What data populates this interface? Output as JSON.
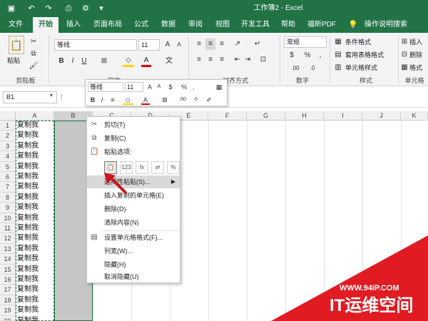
{
  "window": {
    "title": "工作簿2  -  Excel"
  },
  "tabs": [
    {
      "label": "文件"
    },
    {
      "label": "开始"
    },
    {
      "label": "插入"
    },
    {
      "label": "页面布局"
    },
    {
      "label": "公式"
    },
    {
      "label": "数据"
    },
    {
      "label": "审阅"
    },
    {
      "label": "视图"
    },
    {
      "label": "开发工具"
    },
    {
      "label": "帮助"
    },
    {
      "label": "福昕PDF"
    },
    {
      "label": "操作说明搜索"
    }
  ],
  "ribbon": {
    "clipboard": {
      "paste_label": "粘贴",
      "group_label": "剪贴板"
    },
    "font": {
      "name": "等线",
      "size": "11",
      "group_label": "字体"
    },
    "alignment": {
      "group_label": "对齐方式"
    },
    "number": {
      "format": "常规",
      "group_label": "数字"
    },
    "styles": {
      "conditional": "条件格式",
      "table": "套用表格格式",
      "cell": "单元格样式",
      "group_label": "样式"
    },
    "cells": {
      "insert": "插入",
      "delete": "删除",
      "format": "格式",
      "group_label": "单元格"
    }
  },
  "formula_bar": {
    "name_box": "B1"
  },
  "grid": {
    "columns": [
      "A",
      "B",
      "C",
      "D",
      "E",
      "F",
      "G",
      "H",
      "I",
      "J",
      "K"
    ],
    "rows": [
      "1",
      "2",
      "3",
      "4",
      "5",
      "6",
      "7",
      "8",
      "9",
      "10",
      "11",
      "12",
      "13",
      "14",
      "15",
      "16",
      "17",
      "18",
      "19",
      "20"
    ],
    "cell_text": "复制我"
  },
  "mini_toolbar": {
    "font_name": "等线",
    "font_size": "11",
    "percent": "%",
    "comma": ","
  },
  "context_menu": {
    "cut": "剪切(T)",
    "copy": "复制(C)",
    "paste_options": "粘贴选项:",
    "paste_special": "选择性粘贴(S)...",
    "insert_copied": "插入复制的单元格(E)",
    "delete": "删除(D)",
    "clear": "清除内容(N)",
    "format_cells": "设置单元格格式(F)...",
    "col_width": "列宽(W)...",
    "hide": "隐藏(H)",
    "unhide": "取消隐藏(U)"
  },
  "watermark": {
    "url": "WWW.94IP.COM",
    "brand": "IT运维空间"
  },
  "colors": {
    "excel_green": "#217346",
    "watermark_red": "#e01b22"
  }
}
